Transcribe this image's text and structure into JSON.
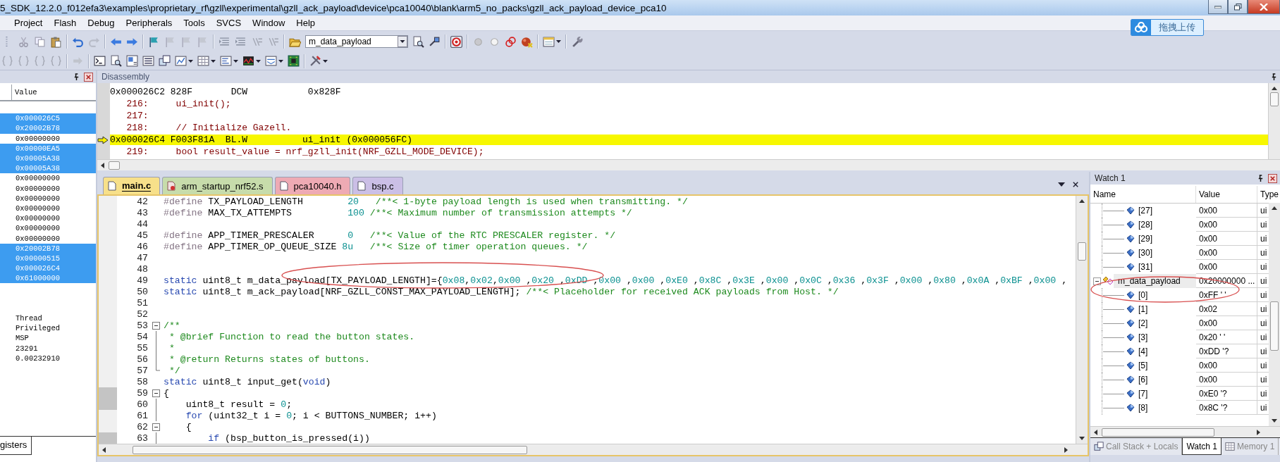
{
  "window": {
    "title": "5_SDK_12.2.0_f012efa3\\examples\\proprietary_rf\\gzll\\experimental\\gzll_ack_payload\\device\\pca10040\\blank\\arm5_no_packs\\gzll_ack_payload_device_pca10"
  },
  "menu": [
    "Project",
    "Flash",
    "Debug",
    "Peripherals",
    "Tools",
    "SVCS",
    "Window",
    "Help"
  ],
  "toolbar": {
    "combo_value": "m_data_payload"
  },
  "upload_button": {
    "label": "拖拽上传"
  },
  "registers": {
    "columns": [
      "Value"
    ],
    "rows": [
      {
        "selected": false
      },
      {
        "value": "0x000026C5",
        "selected": true
      },
      {
        "value": "0x20002B78",
        "selected": true
      },
      {
        "value": "0x00000000",
        "selected": false
      },
      {
        "value": "0x00000EA5",
        "selected": true
      },
      {
        "value": "0x00005A38",
        "selected": true
      },
      {
        "value": "0x00005A38",
        "selected": true
      },
      {
        "value": "0x00000000",
        "selected": false
      },
      {
        "value": "0x00000000",
        "selected": false
      },
      {
        "value": "0x00000000",
        "selected": false
      },
      {
        "value": "0x00000000",
        "selected": false
      },
      {
        "value": "0x00000000",
        "selected": false
      },
      {
        "value": "0x00000000",
        "selected": false
      },
      {
        "value": "0x00000000",
        "selected": false
      },
      {
        "value": "0x20002B78",
        "selected": true
      },
      {
        "value": "0x00000515",
        "selected": true
      },
      {
        "value": "0x000026C4",
        "selected": true
      },
      {
        "value": "0x61000000",
        "selected": true
      },
      {
        "selected": false
      },
      {
        "selected": false
      },
      {
        "selected": false
      },
      {
        "value": "Thread",
        "selected": false
      },
      {
        "value": "Privileged",
        "selected": false
      },
      {
        "value": "MSP",
        "selected": false
      },
      {
        "value": "23291",
        "selected": false
      },
      {
        "value": "0.00232910",
        "selected": false
      }
    ],
    "tabs": [
      {
        "label": "gisters",
        "selected": true
      }
    ]
  },
  "disassembly": {
    "title": "Disassembly",
    "lines": [
      {
        "kind": "asm",
        "text": "0x000026C2 828F       DCW           0x828F",
        "current": false
      },
      {
        "kind": "source",
        "number": "216:",
        "text": "ui_init();"
      },
      {
        "kind": "source",
        "number": "217:"
      },
      {
        "kind": "source",
        "number": "218:",
        "text": "// Initialize Gazell."
      },
      {
        "kind": "asm",
        "text": "0x000026C4 F003F81A  BL.W          ui_init (0x000056FC)",
        "current": true
      },
      {
        "kind": "source",
        "number": "219:",
        "text": "bool result_value = nrf_gzll_init(NRF_GZLL_MODE_DEVICE);"
      }
    ]
  },
  "editor": {
    "tabs": [
      {
        "label": "main.c",
        "kind": "c",
        "color": "#f7e08a",
        "selected": true
      },
      {
        "label": "arm_startup_nrf52.s",
        "kind": "asm",
        "color": "#c7dcab",
        "selected": false
      },
      {
        "label": "pca10040.h",
        "kind": "h",
        "color": "#eeaab4",
        "selected": false
      },
      {
        "label": "bsp.c",
        "kind": "c",
        "color": "#cbbfe6",
        "selected": false
      }
    ],
    "lines": [
      {
        "number": "42",
        "marked": false,
        "segments": [
          {
            "kind": "directive",
            "text": "#define"
          },
          {
            "kind": "plain",
            "text": " TX_PAYLOAD_LENGTH        "
          },
          {
            "kind": "number",
            "text": "20"
          },
          {
            "kind": "comment",
            "text": "   /**< 1-byte payload length is used when transmitting. */"
          }
        ]
      },
      {
        "number": "43",
        "marked": false,
        "segments": [
          {
            "kind": "directive",
            "text": "#define"
          },
          {
            "kind": "plain",
            "text": " MAX_TX_ATTEMPTS          "
          },
          {
            "kind": "number",
            "text": "100"
          },
          {
            "kind": "comment",
            "text": " /**< Maximum number of transmission attempts */"
          }
        ]
      },
      {
        "number": "44",
        "marked": false
      },
      {
        "number": "45",
        "marked": false,
        "segments": [
          {
            "kind": "directive",
            "text": "#define"
          },
          {
            "kind": "plain",
            "text": " APP_TIMER_PRESCALER      "
          },
          {
            "kind": "number",
            "text": "0"
          },
          {
            "kind": "comment",
            "text": "   /**< Value of the RTC PRESCALER register. */"
          }
        ]
      },
      {
        "number": "46",
        "marked": false,
        "segments": [
          {
            "kind": "directive",
            "text": "#define"
          },
          {
            "kind": "plain",
            "text": " APP_TIMER_OP_QUEUE_SIZE "
          },
          {
            "kind": "number",
            "text": "8u"
          },
          {
            "kind": "comment",
            "text": "   /**< Size of timer operation queues. */"
          }
        ]
      },
      {
        "number": "47",
        "marked": false
      },
      {
        "number": "48",
        "marked": false
      },
      {
        "number": "49",
        "marked": false,
        "segments": [
          {
            "kind": "keyword",
            "text": "static"
          },
          {
            "kind": "plain",
            "text": " uint8_t m_data_payload[TX_PAYLOAD_LENGTH]={"
          },
          {
            "kind": "number",
            "text": "0x08"
          },
          {
            "kind": "plain",
            "text": ","
          },
          {
            "kind": "number",
            "text": "0x02"
          },
          {
            "kind": "plain",
            "text": ","
          },
          {
            "kind": "number",
            "text": "0x00"
          },
          {
            "kind": "plain",
            "text": " ,"
          },
          {
            "kind": "number",
            "text": "0x20"
          },
          {
            "kind": "plain",
            "text": " ,"
          },
          {
            "kind": "number",
            "text": "0xDD"
          },
          {
            "kind": "plain",
            "text": " ,"
          },
          {
            "kind": "number",
            "text": "0x00"
          },
          {
            "kind": "plain",
            "text": " ,"
          },
          {
            "kind": "number",
            "text": "0x00"
          },
          {
            "kind": "plain",
            "text": " ,"
          },
          {
            "kind": "number",
            "text": "0xE0"
          },
          {
            "kind": "plain",
            "text": " ,"
          },
          {
            "kind": "number",
            "text": "0x8C"
          },
          {
            "kind": "plain",
            "text": " ,"
          },
          {
            "kind": "number",
            "text": "0x3E"
          },
          {
            "kind": "plain",
            "text": " ,"
          },
          {
            "kind": "number",
            "text": "0x00"
          },
          {
            "kind": "plain",
            "text": " ,"
          },
          {
            "kind": "number",
            "text": "0x0C"
          },
          {
            "kind": "plain",
            "text": " ,"
          },
          {
            "kind": "number",
            "text": "0x36"
          },
          {
            "kind": "plain",
            "text": " ,"
          },
          {
            "kind": "number",
            "text": "0x3F"
          },
          {
            "kind": "plain",
            "text": " ,"
          },
          {
            "kind": "number",
            "text": "0x00"
          },
          {
            "kind": "plain",
            "text": " ,"
          },
          {
            "kind": "number",
            "text": "0x80"
          },
          {
            "kind": "plain",
            "text": " ,"
          },
          {
            "kind": "number",
            "text": "0x0A"
          },
          {
            "kind": "plain",
            "text": " ,"
          },
          {
            "kind": "number",
            "text": "0xBF"
          },
          {
            "kind": "plain",
            "text": " ,"
          },
          {
            "kind": "number",
            "text": "0x00"
          },
          {
            "kind": "plain",
            "text": " ,"
          }
        ]
      },
      {
        "number": "50",
        "marked": false,
        "segments": [
          {
            "kind": "keyword",
            "text": "static"
          },
          {
            "kind": "plain",
            "text": " uint8_t m_ack_payload[NRF_GZLL_CONST_MAX_PAYLOAD_LENGTH]; "
          },
          {
            "kind": "comment",
            "text": "/**< Placeholder for received ACK payloads from Host. */"
          }
        ]
      },
      {
        "number": "51",
        "marked": false
      },
      {
        "number": "52",
        "marked": false
      },
      {
        "number": "53",
        "marked": false,
        "kind": "start",
        "segments": [
          {
            "kind": "comment",
            "text": "/**"
          }
        ]
      },
      {
        "number": "54",
        "marked": false,
        "kind": "line",
        "segments": [
          {
            "kind": "comment",
            "text": " * @brief Function to read the button states."
          }
        ]
      },
      {
        "number": "55",
        "marked": false,
        "kind": "line",
        "segments": [
          {
            "kind": "comment",
            "text": " *"
          }
        ]
      },
      {
        "number": "56",
        "marked": false,
        "kind": "line",
        "segments": [
          {
            "kind": "comment",
            "text": " * @return Returns states of buttons."
          }
        ]
      },
      {
        "number": "57",
        "marked": false,
        "kind": "end",
        "segments": [
          {
            "kind": "comment",
            "text": " */"
          }
        ]
      },
      {
        "number": "58",
        "marked": false,
        "segments": [
          {
            "kind": "keyword",
            "text": "static"
          },
          {
            "kind": "plain",
            "text": " uint8_t input_get("
          },
          {
            "kind": "keyword",
            "text": "void"
          },
          {
            "kind": "plain",
            "text": ")"
          }
        ]
      },
      {
        "number": "59",
        "marked": true,
        "kind": "start",
        "segments": [
          {
            "kind": "plain",
            "text": "{"
          }
        ]
      },
      {
        "number": "60",
        "marked": true,
        "kind": "line",
        "segments": [
          {
            "kind": "plain",
            "text": "    uint8_t result = "
          },
          {
            "kind": "number",
            "text": "0"
          },
          {
            "kind": "plain",
            "text": ";"
          }
        ]
      },
      {
        "number": "61",
        "marked": false,
        "kind": "line",
        "segments": [
          {
            "kind": "keyword",
            "text": "    for"
          },
          {
            "kind": "plain",
            "text": " (uint32_t i = "
          },
          {
            "kind": "number",
            "text": "0"
          },
          {
            "kind": "plain",
            "text": "; i < BUTTONS_NUMBER; i++)"
          }
        ]
      },
      {
        "number": "62",
        "marked": false,
        "kind": "start",
        "segments": [
          {
            "kind": "plain",
            "text": "    {"
          }
        ]
      },
      {
        "number": "63",
        "marked": true,
        "kind": "line",
        "segments": [
          {
            "kind": "keyword",
            "text": "        if"
          },
          {
            "kind": "plain",
            "text": " (bsp_button_is_pressed(i))"
          }
        ]
      }
    ]
  },
  "watch": {
    "title": "Watch 1",
    "columns": [
      "Name",
      "Value",
      "Type"
    ],
    "rows": [
      {
        "kind": "element",
        "name": "[27]",
        "value": "0x00",
        "type": "ui"
      },
      {
        "kind": "element",
        "name": "[28]",
        "value": "0x00",
        "type": "ui"
      },
      {
        "kind": "element",
        "name": "[29]",
        "value": "0x00",
        "type": "ui"
      },
      {
        "kind": "element",
        "name": "[30]",
        "value": "0x00",
        "type": "ui"
      },
      {
        "kind": "element",
        "name": "[31]",
        "value": "0x00",
        "type": "ui"
      },
      {
        "kind": "variable",
        "name": "m_data_payload",
        "value": "0x20000000 ...",
        "type": "ui",
        "expanded": true,
        "children": [
          {
            "kind": "element",
            "name": "[0]",
            "value": "0xFF ' '",
            "type": "ui"
          },
          {
            "kind": "element",
            "name": "[1]",
            "value": "0x02",
            "type": "ui"
          },
          {
            "kind": "element",
            "name": "[2]",
            "value": "0x00",
            "type": "ui"
          },
          {
            "kind": "element",
            "name": "[3]",
            "value": "0x20 ' '",
            "type": "ui"
          },
          {
            "kind": "element",
            "name": "[4]",
            "value": "0xDD '?",
            "type": "ui"
          },
          {
            "kind": "element",
            "name": "[5]",
            "value": "0x00",
            "type": "ui"
          },
          {
            "kind": "element",
            "name": "[6]",
            "value": "0x00",
            "type": "ui"
          },
          {
            "kind": "element",
            "name": "[7]",
            "value": "0xE0 '?",
            "type": "ui"
          },
          {
            "kind": "element",
            "name": "[8]",
            "value": "0x8C '?",
            "type": "ui"
          }
        ]
      }
    ],
    "tabs": [
      {
        "label": "Call Stack + Locals",
        "kind": "callstack",
        "selected": false
      },
      {
        "label": "Watch 1",
        "kind": "watch",
        "selected": true
      },
      {
        "label": "Memory 1",
        "kind": "memory",
        "selected": false
      }
    ]
  }
}
